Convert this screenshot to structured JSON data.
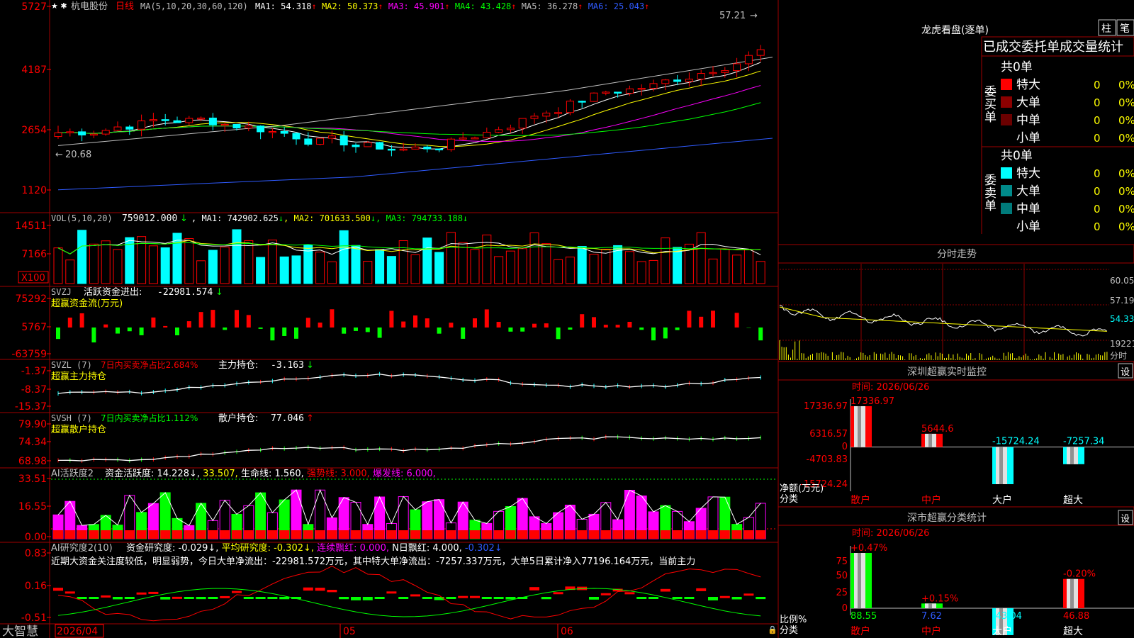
{
  "stock": {
    "name": "杭电股份",
    "period": "日线",
    "ma_label": "MA(5,10,20,30,60,120)",
    "ma_values": [
      {
        "label": "MA1:",
        "value": "54.318",
        "arrow": "↑",
        "color": "#ffffff"
      },
      {
        "label": "MA2:",
        "value": "50.373",
        "arrow": "↑",
        "color": "#ffff00"
      },
      {
        "label": "MA3:",
        "value": "45.901",
        "arrow": "↑",
        "color": "#ff00ff"
      },
      {
        "label": "MA4:",
        "value": "43.428",
        "arrow": "↑",
        "color": "#00ff00"
      },
      {
        "label": "MA5:",
        "value": "36.278",
        "arrow": "↑",
        "color": "#c0c0c0"
      },
      {
        "label": "MA6:",
        "value": "25.043",
        "arrow": "↑",
        "color": "#2f5bff"
      }
    ],
    "high_mark": "57.21",
    "low_mark": "20.68",
    "y_ticks": [
      "5727",
      "4187",
      "2654",
      "1120"
    ]
  },
  "volume": {
    "label": "VOL(5,10,20)",
    "value": "759012.000",
    "ma": [
      {
        "label": "MA1:",
        "value": "742902.625",
        "color": "#ffffff"
      },
      {
        "label": "MA2:",
        "value": "701633.500",
        "color": "#ffff00"
      },
      {
        "label": "MA3:",
        "value": "794733.188",
        "color": "#00ff00"
      }
    ],
    "y_ticks": [
      "14511",
      "7166"
    ],
    "unit": "X100"
  },
  "svzj": {
    "label": "SVZJ",
    "name": "活跃资金进出:",
    "value": "-22981.574",
    "arrow": "↓",
    "subtitle": "超赢资金流(万元)",
    "y_ticks": [
      "75292",
      "5767",
      "-63759"
    ]
  },
  "svzl": {
    "label": "SVZL (7)",
    "desc": "7日内买卖净占比2.684%",
    "name": "主力持仓:",
    "value": "-3.163",
    "arrow": "↓",
    "subtitle": "超赢主力持仓",
    "y_ticks": [
      "-1.37",
      "-8.37",
      "-15.37"
    ]
  },
  "svsh": {
    "label": "SVSH (7)",
    "desc": "7日内买卖净占比1.112%",
    "name": "散户持仓:",
    "value": "77.046",
    "arrow": "↑",
    "subtitle": "超赢散户持仓",
    "y_ticks": [
      "79.90",
      "74.34",
      "68.98"
    ]
  },
  "ai_active": {
    "label": "AI活跃度2",
    "items": [
      {
        "text": "资金活跃度: 14.228↓,",
        "color": "#ffffff"
      },
      {
        "text": "33.507,",
        "color": "#ffff00"
      },
      {
        "text": "生命线: 1.560,",
        "color": "#ffffff"
      },
      {
        "text": "强势线: 3.000,",
        "color": "#ff0000"
      },
      {
        "text": "爆发线: 6.000,",
        "color": "#ff00ff"
      }
    ],
    "y_ticks": [
      "33.51",
      "16.55",
      "0.00"
    ]
  },
  "ai_research": {
    "label": "AI研究度2(10)",
    "items": [
      {
        "text": "资金研究度: -0.029↓,",
        "color": "#ffffff"
      },
      {
        "text": "平均研究度: -0.302↓,",
        "color": "#ffff00"
      },
      {
        "text": "连续飘红: 0.000,",
        "color": "#ff00ff"
      },
      {
        "text": "N日飘红: 4.000,",
        "color": "#ffffff"
      },
      {
        "text": "-0.302↓",
        "color": "#2f5bff"
      }
    ],
    "comment": "近期大资金关注度较低，明显弱势，今日大单净流出：-22981.572万元，其中特大单净流出：-7257.337万元，大单5日累计净入77196.164万元，当前主力",
    "y_ticks": [
      "0.83",
      "0.16",
      "-0.51"
    ]
  },
  "date_axis": {
    "labels": [
      "2026/04",
      "05",
      "06"
    ]
  },
  "brand": "大智慧",
  "right_panel": {
    "title": "龙虎看盘(逐单)",
    "btn_zhu": "柱",
    "btn_bi": "笔",
    "table_header": "已成交委托单成交量统计",
    "buy_group": {
      "label": "委买单",
      "total": "共0单",
      "rows": [
        {
          "name": "特大",
          "count": "0",
          "pct": "0%",
          "color": "#ff0000"
        },
        {
          "name": "大单",
          "count": "0",
          "pct": "0%",
          "color": "#8b0000"
        },
        {
          "name": "中单",
          "count": "0",
          "pct": "0%",
          "color": "#6b0000"
        },
        {
          "name": "小单",
          "count": "0",
          "pct": "0%",
          "color": ""
        }
      ]
    },
    "sell_group": {
      "label": "委卖单",
      "total": "共0单",
      "rows": [
        {
          "name": "特大",
          "count": "0",
          "pct": "0%",
          "color": "#00ffff"
        },
        {
          "name": "大单",
          "count": "0",
          "pct": "0%",
          "color": "#008b8b"
        },
        {
          "name": "中单",
          "count": "0",
          "pct": "0%",
          "color": "#007b7b"
        },
        {
          "name": "小单",
          "count": "0",
          "pct": "0%",
          "color": ""
        }
      ]
    },
    "intraday": {
      "title": "分时走势",
      "y_ticks": [
        "60.05",
        "57.19",
        "54.33"
      ],
      "vol_tick": "19221",
      "vol_unit": "分时"
    },
    "monitor": {
      "title": "深圳超赢实时监控",
      "set_btn": "设",
      "time": "时间: 2026/06/26",
      "y_ticks": [
        "17336.97",
        "6316.57",
        "0",
        "-4703.83",
        "-15724.24"
      ],
      "axis_label_1": "净额(万元)",
      "axis_label_2": "分类",
      "bars": [
        {
          "cat": "散户",
          "value": 17336.97,
          "label": "17336.97"
        },
        {
          "cat": "中户",
          "value": 5644.6,
          "label": "5644.6"
        },
        {
          "cat": "大户",
          "value": -15724.24,
          "label": "-15724.24"
        },
        {
          "cat": "超大",
          "value": -7257.34,
          "label": "-7257.34"
        }
      ]
    },
    "stats": {
      "title": "深市超赢分类统计",
      "set_btn": "设",
      "time": "时间: 2026/06/26",
      "y_ticks": [
        "75",
        "50",
        "25",
        "0"
      ],
      "axis_label_1": "比例%",
      "axis_label_2": "分类",
      "bars": [
        {
          "cat": "散户",
          "value": 88.55,
          "label": "88.55",
          "top": "+0.47%"
        },
        {
          "cat": "中户",
          "value": 7.62,
          "label": "7.62",
          "top": "+0.15%"
        },
        {
          "cat": "大户",
          "value": -43.04,
          "label": "-43.04",
          "top": ""
        },
        {
          "cat": "超大",
          "value": 46.88,
          "label": "46.88",
          "top": "-0.20%"
        }
      ]
    }
  },
  "chart_data": [
    {
      "type": "bar",
      "title": "深圳超赢实时监控",
      "categories": [
        "散户",
        "中户",
        "大户",
        "超大"
      ],
      "values": [
        17336.97,
        5644.6,
        -15724.24,
        -7257.34
      ],
      "ylabel": "净额(万元)",
      "xlabel": "分类",
      "ylim": [
        -15724.24,
        17336.97
      ]
    },
    {
      "type": "bar",
      "title": "深市超赢分类统计",
      "categories": [
        "散户",
        "中户",
        "大户",
        "超大"
      ],
      "values": [
        88.55,
        7.62,
        -43.04,
        46.88
      ],
      "ylabel": "比例%",
      "xlabel": "分类",
      "ylim": [
        0,
        88.55
      ]
    }
  ],
  "colors": {
    "up": "#ff0000",
    "down": "#00ffff",
    "grid": "#8b0000",
    "text": "#c0c0c0"
  }
}
